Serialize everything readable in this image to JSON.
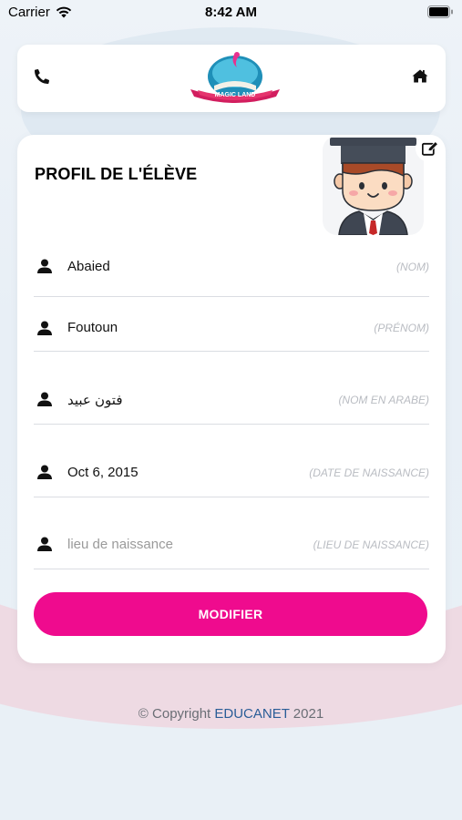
{
  "status_bar": {
    "carrier": "Carrier",
    "time": "8:42 AM"
  },
  "header": {
    "logo_text": "MAGIC LAND",
    "icons": [
      "phone-icon",
      "home-icon"
    ]
  },
  "profile": {
    "title": "PROFIL DE L'ÉLÈVE",
    "fields": [
      {
        "value": "Abaied",
        "label": "(NOM)",
        "is_placeholder": false
      },
      {
        "value": "Foutoun",
        "label": "(PRÉNOM)",
        "is_placeholder": false
      },
      {
        "value": "فتون عبيد",
        "label": "(NOM EN ARABE)",
        "is_placeholder": false
      },
      {
        "value": "Oct 6, 2015",
        "label": "(DATE DE NAISSANCE)",
        "is_placeholder": false
      },
      {
        "value": "lieu de naissance",
        "label": "(LIEU DE NAISSANCE)",
        "is_placeholder": true
      }
    ],
    "button_label": "MODIFIER"
  },
  "footer": {
    "prefix": "© Copyright ",
    "brand": "EDUCANET",
    "year": " 2021"
  },
  "colors": {
    "accent": "#ef0b8e",
    "brand_blue": "#2a5d97"
  }
}
